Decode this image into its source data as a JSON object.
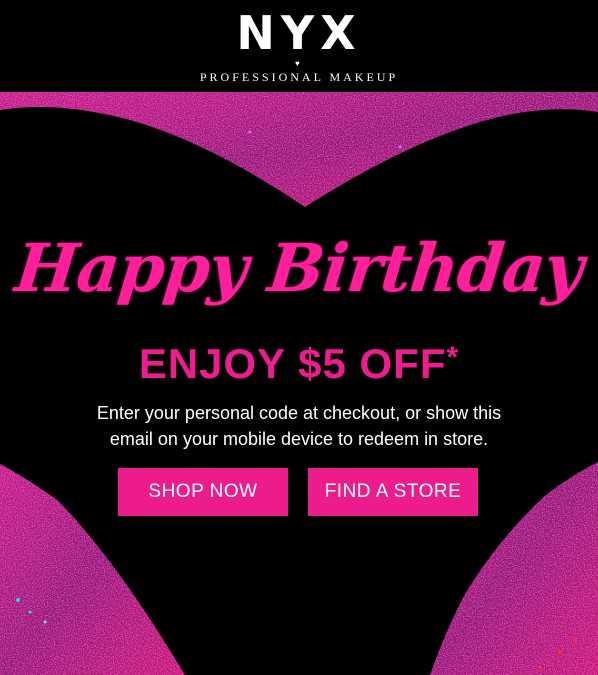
{
  "logo": {
    "wordmark": "NYX",
    "heart": "♥",
    "tagline": "PROFESSIONAL MAKEUP"
  },
  "hero": {
    "headline": "Happy Birthday",
    "offer": "ENJOY $5 OFF",
    "offer_mark": "*",
    "body_line1": "Enter your personal code at checkout, or show this",
    "body_line2": "email on your mobile device to redeem in store."
  },
  "buttons": {
    "shop_label": "SHOP NOW",
    "store_label": "FIND A STORE"
  },
  "colors": {
    "brand_pink": "#ec1c8c",
    "background": "#000000",
    "text": "#ffffff"
  }
}
